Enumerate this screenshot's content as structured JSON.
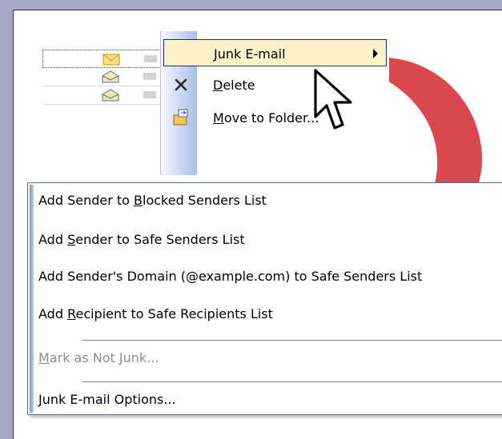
{
  "context_menu": {
    "items": [
      {
        "pre": "",
        "accel": "J",
        "post": "unk E-mail",
        "has_submenu": true,
        "icon": ""
      },
      {
        "pre": "",
        "accel": "D",
        "post": "elete",
        "has_submenu": false,
        "icon": "delete-x-icon"
      },
      {
        "pre": "",
        "accel": "M",
        "post": "ove to Folder...",
        "has_submenu": false,
        "icon": "move-to-folder-icon"
      }
    ]
  },
  "junk_submenu": {
    "items": [
      {
        "pre": "Add Sender to ",
        "accel": "B",
        "post": "locked Senders List",
        "enabled": true
      },
      {
        "pre": "Add ",
        "accel": "S",
        "post": "ender to Safe Senders List",
        "enabled": true
      },
      {
        "pre": "Add Sender's Domain (@example.com) to Safe Senders List",
        "accel": "",
        "post": "",
        "enabled": true
      },
      {
        "pre": "Add ",
        "accel": "R",
        "post": "ecipient to Safe Recipients List",
        "enabled": true
      },
      {
        "pre": "",
        "accel": "M",
        "post": "ark as Not Junk...",
        "enabled": false
      },
      {
        "pre": "",
        "accel": "J",
        "post": "unk E-mail Options...",
        "enabled": true
      }
    ]
  },
  "colors": {
    "highlight_bg": "#fff2c9",
    "highlight_border": "#1e2e74",
    "swoosh": "#d9484f",
    "desktop": "#a4a7c3"
  },
  "icons": [
    "envelope-closed-icon",
    "envelope-open-icon",
    "delete-x-icon",
    "move-to-folder-icon",
    "submenu-arrow-icon",
    "mouse-pointer-icon"
  ]
}
